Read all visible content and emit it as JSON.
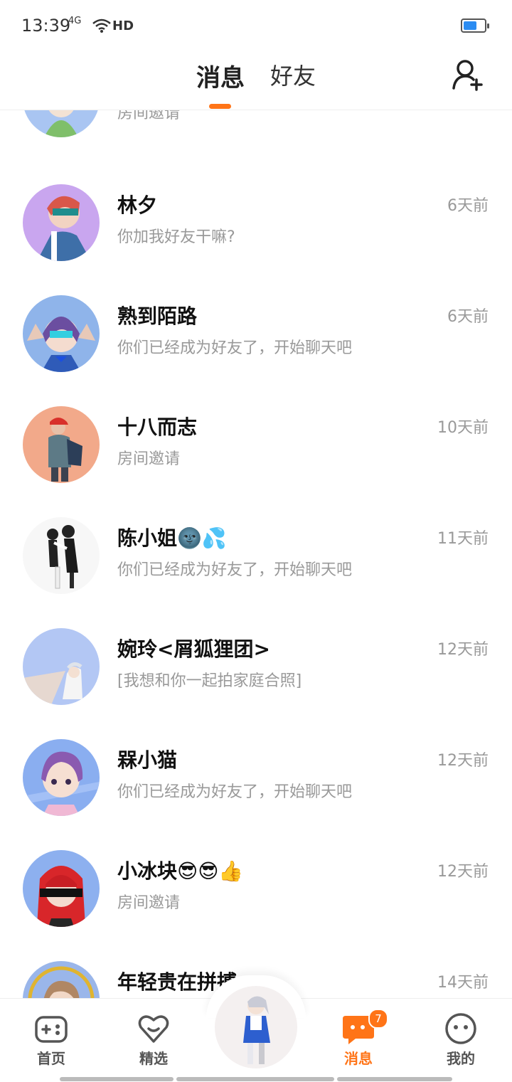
{
  "status_bar": {
    "time": "13:39",
    "network": "4G",
    "hd": "HD"
  },
  "header": {
    "tabs": [
      {
        "label": "消息",
        "active": true
      },
      {
        "label": "好友",
        "active": false
      }
    ],
    "add_friend_icon": "add-user-icon",
    "accent": "#ff7417"
  },
  "conversations": [
    {
      "name": "",
      "preview": "房间邀请",
      "time": ""
    },
    {
      "name": "林夕",
      "preview": "你加我好友干嘛?",
      "time": "6天前"
    },
    {
      "name": "熟到陌路",
      "preview": "你们已经成为好友了，开始聊天吧",
      "time": "6天前"
    },
    {
      "name": "十八而志",
      "preview": "房间邀请",
      "time": "10天前"
    },
    {
      "name": "陈小姐🌚💦",
      "preview": "你们已经成为好友了，开始聊天吧",
      "time": "11天前"
    },
    {
      "name": "婉玲<屑狐狸团>",
      "preview": "[我想和你一起拍家庭合照]",
      "time": "12天前"
    },
    {
      "name": "槑小猫",
      "preview": "你们已经成为好友了，开始聊天吧",
      "time": "12天前"
    },
    {
      "name": "小冰块😎😎👍",
      "preview": "房间邀请",
      "time": "12天前"
    },
    {
      "name": "年轻贵在拼搏",
      "preview": "",
      "time": "14天前"
    }
  ],
  "bottom_nav": [
    {
      "label": "首页",
      "icon": "gamepad-icon"
    },
    {
      "label": "精选",
      "icon": "heart-icon"
    },
    {
      "label": "",
      "icon": "avatar-character"
    },
    {
      "label": "消息",
      "icon": "chat-icon",
      "badge": "7",
      "active": true
    },
    {
      "label": "我的",
      "icon": "face-icon"
    }
  ]
}
